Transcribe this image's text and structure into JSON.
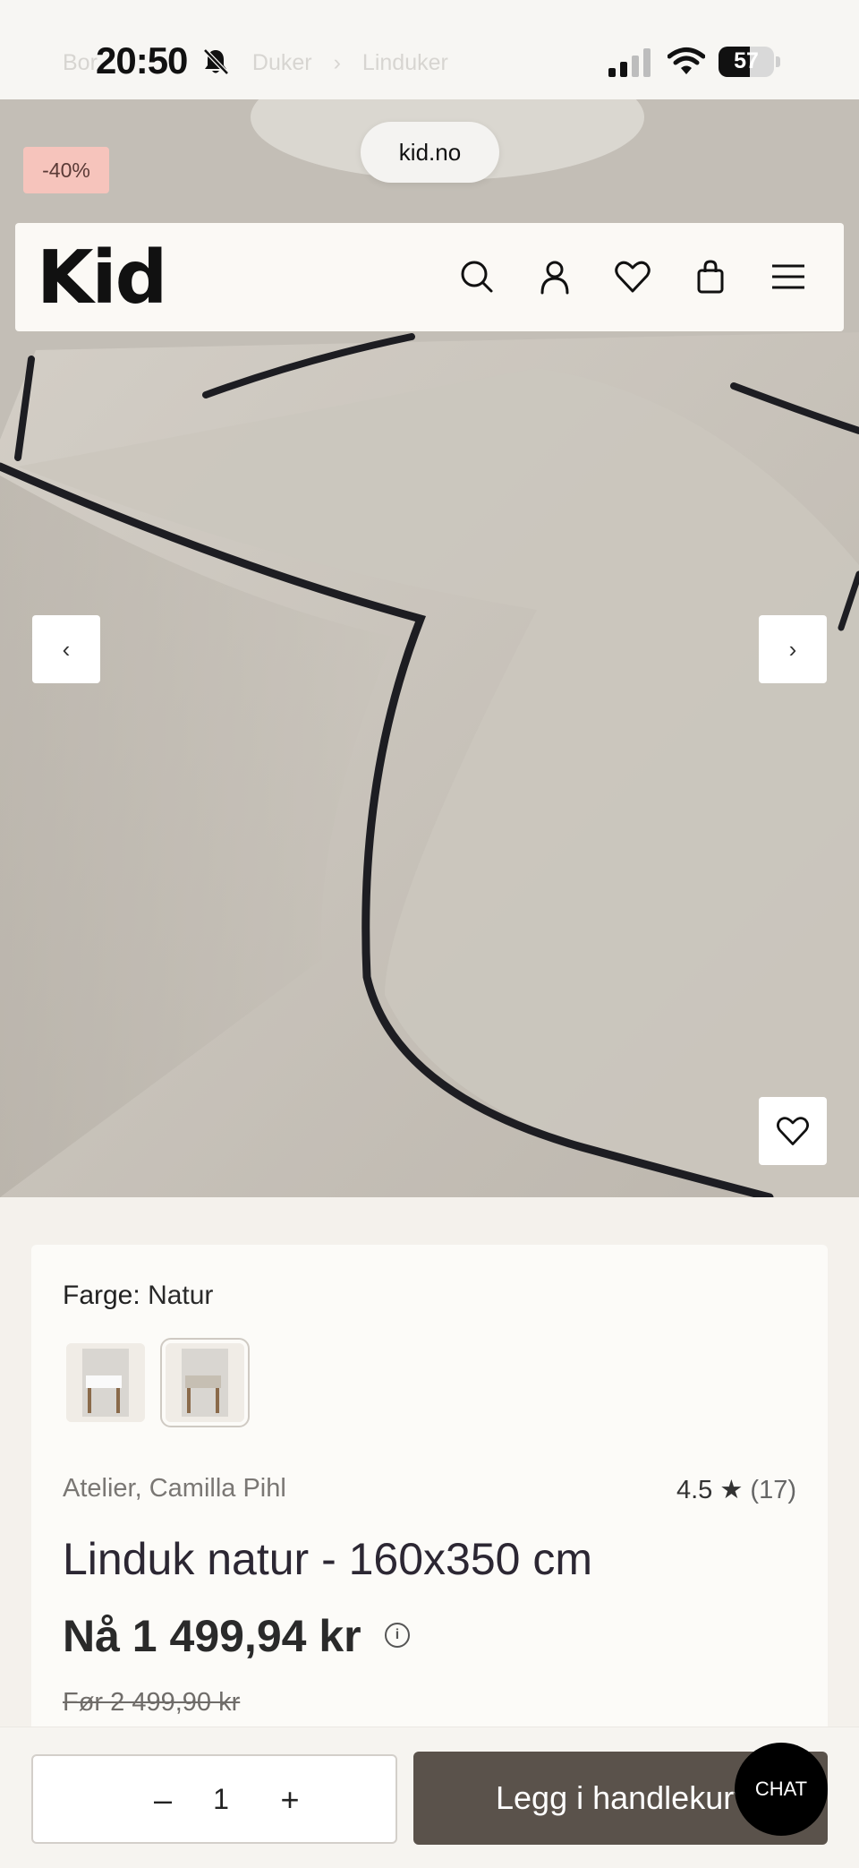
{
  "status_bar": {
    "time": "20:50",
    "battery": "57",
    "battery_level_percent": 57,
    "breadcrumb": [
      "Bor",
      "Duker",
      "Linduker"
    ]
  },
  "browser": {
    "url": "kid.no"
  },
  "product_image": {
    "discount_badge": "-40%"
  },
  "header": {
    "logo": "Kid",
    "icons": [
      "search-icon",
      "account-icon",
      "wishlist-icon",
      "bag-icon",
      "menu-icon"
    ]
  },
  "gallery": {
    "prev_label": "‹",
    "next_label": "›"
  },
  "product": {
    "color_label": "Farge:",
    "color_value": "Natur",
    "brand": "Atelier, Camilla Pihl",
    "rating": "4.5",
    "rating_star": "★",
    "review_count": "(17)",
    "title": "Linduk natur - 160x350 cm",
    "price": "Nå 1 499,94 kr",
    "old_price": "Før 2 499,90 kr"
  },
  "purchase": {
    "quantity": "1",
    "minus": "–",
    "plus": "+",
    "add_to_cart": "Legg i handlekurv",
    "chat": "CHAT"
  },
  "colors": {
    "cart_button": "#5a524b",
    "badge": "#f6c4bc",
    "chat": "#000000"
  }
}
